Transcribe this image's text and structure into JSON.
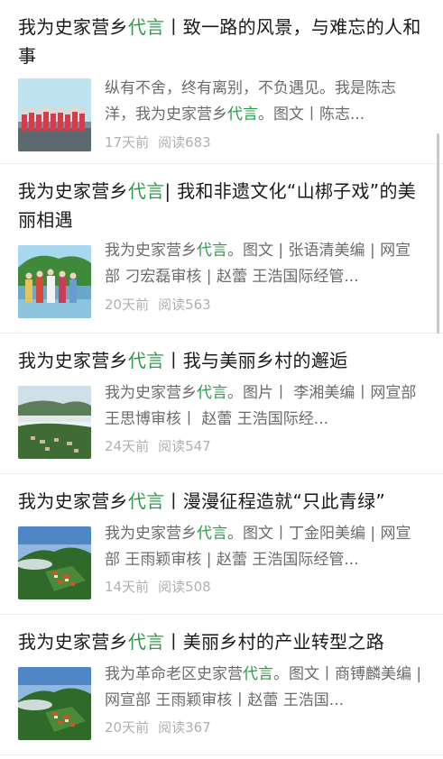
{
  "articles": [
    {
      "title_prefix": "我为史家营乡",
      "title_highlight": "代言",
      "title_suffix": "丨致一路的风景，与难忘的人和事",
      "summary_prefix": "纵有不舍，终有离别，不负遇见。我是陈志洋，我为史家营乡",
      "summary_highlight": "代言",
      "summary_suffix": "。图文丨陈志...",
      "time": "17天前",
      "reads": "阅读683",
      "thumb_icon": "group-photo-thumbnail"
    },
    {
      "title_prefix": "我为史家营乡",
      "title_highlight": "代言",
      "title_suffix": "| 我和非遗文化“山梆子戏”的美丽相遇",
      "summary_prefix": "我为史家营乡",
      "summary_highlight": "代言",
      "summary_suffix": "。图文 | 张语清美编 | 网宣部 刁宏磊审核 | 赵蕾 王浩国际经管...",
      "time": "20天前",
      "reads": "阅读563",
      "thumb_icon": "opera-performers-thumbnail"
    },
    {
      "title_prefix": "我为史家营乡",
      "title_highlight": "代言",
      "title_suffix": "丨我与美丽乡村的邂逅",
      "summary_prefix": "我为史家营乡",
      "summary_highlight": "代言",
      "summary_suffix": "。图片丨 李湘美编丨网宣部 王思博审核丨 赵蕾 王浩国际经...",
      "time": "24天前",
      "reads": "阅读547",
      "thumb_icon": "mountain-village-thumbnail"
    },
    {
      "title_prefix": "我为史家营乡",
      "title_highlight": "代言",
      "title_suffix": "丨漫漫征程造就“只此青绿”",
      "summary_prefix": "我为史家营乡",
      "summary_highlight": "代言",
      "summary_suffix": "。图文丨丁金阳美编 | 网宣部 王雨颖审核 | 赵蕾 王浩国际经管...",
      "time": "14天前",
      "reads": "阅读508",
      "thumb_icon": "mountain-resort-thumbnail"
    },
    {
      "title_prefix": "我为史家营乡",
      "title_highlight": "代言",
      "title_suffix": "丨美丽乡村的产业转型之路",
      "summary_prefix": "我为革命老区史家营",
      "summary_highlight": "代言",
      "summary_suffix": "。图文丨商镈麟美编 | 网宣部 王雨颖审核丨赵蕾 王浩国...",
      "time": "20天前",
      "reads": "阅读367",
      "thumb_icon": "mountain-resort-thumbnail"
    }
  ]
}
